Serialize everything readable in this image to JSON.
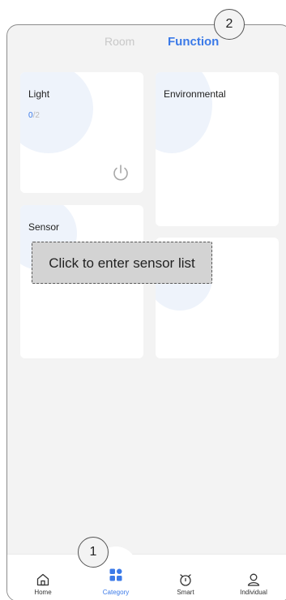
{
  "header": {
    "tabs": [
      {
        "label": "Room",
        "active": false
      },
      {
        "label": "Function",
        "active": true
      }
    ]
  },
  "cards": {
    "light": {
      "title": "Light",
      "on_count": "0",
      "total": "/2"
    },
    "environmental": {
      "title": "Environmental"
    },
    "sensor": {
      "title": "Sensor"
    }
  },
  "tooltip": {
    "text": "Click to enter sensor list"
  },
  "markers": {
    "one": "1",
    "two": "2"
  },
  "nav": {
    "items": [
      {
        "label": "Home",
        "icon": "home-icon"
      },
      {
        "label": "Category",
        "icon": "category-icon",
        "active": true
      },
      {
        "label": "Smart",
        "icon": "smart-icon"
      },
      {
        "label": "Individual",
        "icon": "user-icon"
      }
    ]
  },
  "colors": {
    "accent": "#3b7ae8",
    "background": "#f3f3f3",
    "card": "#ffffff",
    "muted": "#c8c8c8"
  }
}
